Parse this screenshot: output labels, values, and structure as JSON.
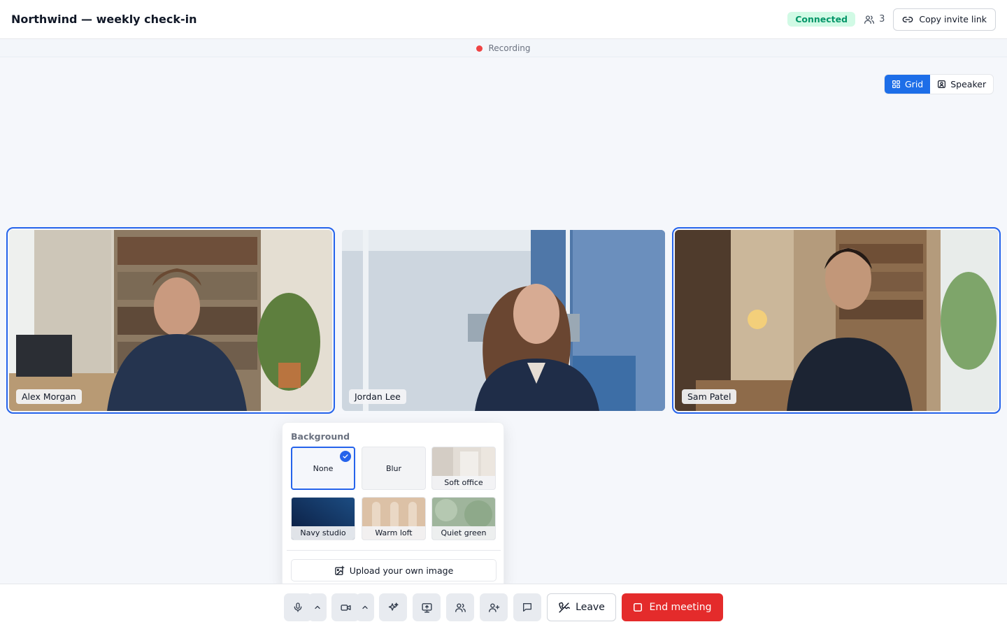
{
  "header": {
    "title": "Northwind — weekly check-in",
    "status": "Connected",
    "participant_count": "3",
    "invite_label": "Copy invite link"
  },
  "recording": {
    "label": "Recording"
  },
  "view_toggle": {
    "grid_label": "Grid",
    "speaker_label": "Speaker",
    "active": "Grid"
  },
  "participants": [
    {
      "name": "Alex Morgan",
      "active": true
    },
    {
      "name": "Jordan Lee",
      "active": false
    },
    {
      "name": "Sam Patel",
      "active": true
    }
  ],
  "background_picker": {
    "title": "Background",
    "selected": "None",
    "options": [
      {
        "label": "None"
      },
      {
        "label": "Blur"
      },
      {
        "label": "Soft office"
      },
      {
        "label": "Navy studio"
      },
      {
        "label": "Warm loft"
      },
      {
        "label": "Quiet green"
      }
    ],
    "upload_label": "Upload your own image"
  },
  "toolbar": {
    "leave_label": "Leave",
    "end_label": "End meeting"
  },
  "icons": {
    "participants": "users-icon",
    "invite": "link-icon",
    "mic": "microphone-icon",
    "camera": "video-camera-icon",
    "effects": "sparkles-icon",
    "share": "screen-share-icon",
    "people": "people-icon",
    "add_person": "user-plus-icon",
    "chat": "chat-bubble-icon",
    "leave": "phone-off-icon",
    "end": "stop-square-icon"
  },
  "colors": {
    "accent": "#1d6ee8",
    "connected_bg": "#d1fae5",
    "connected_text": "#059669",
    "recording_dot": "#ef4444",
    "end_meeting": "#e42b2b"
  }
}
